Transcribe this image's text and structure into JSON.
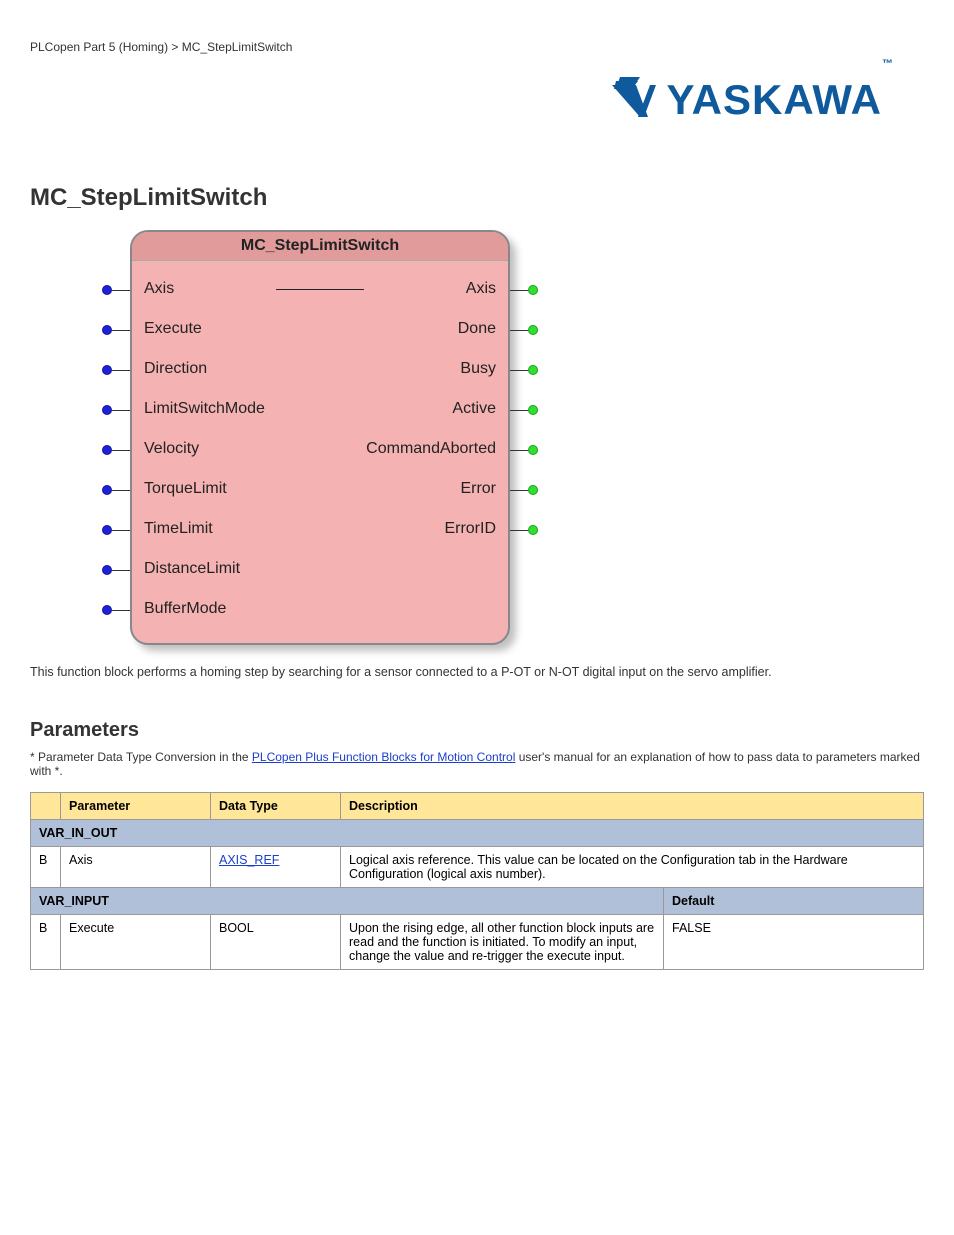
{
  "breadcrumb": "PLCopen Part 5 (Homing) > MC_StepLimitSwitch",
  "logo_text": "YASKAWA",
  "heading": "MC_StepLimitSwitch",
  "fb": {
    "title": "MC_StepLimitSwitch",
    "inputs": [
      "Axis",
      "Execute",
      "Direction",
      "LimitSwitchMode",
      "Velocity",
      "TorqueLimit",
      "TimeLimit",
      "DistanceLimit",
      "BufferMode"
    ],
    "outputs": [
      "Axis",
      "Done",
      "Busy",
      "Active",
      "CommandAborted",
      "Error",
      "ErrorID"
    ]
  },
  "desc": "This function block performs a homing step by searching for a sensor connected to a P-OT or N-OT digital input on the servo amplifier.",
  "params_heading": "Parameters",
  "note_pre": "* Parameter Data Type Conversion in the ",
  "note_link": "PLCopen Plus Function Blocks for Motion Control",
  "note_post": " user's manual for an explanation of how to pass data to parameters marked with *.",
  "table": {
    "header": [
      "",
      "Parameter",
      "Data Type",
      "Description",
      ""
    ],
    "var_in_out": "VAR_IN_OUT",
    "row1": {
      "b": "B",
      "param": "Axis",
      "type": "AXIS_REF",
      "desc": "Logical axis reference. This value can be located on the Configuration tab in the Hardware Configuration (logical axis number)."
    },
    "var_input": "VAR_INPUT",
    "var_input_default": "Default",
    "row2": {
      "b": "B",
      "param": "Execute",
      "type": "BOOL",
      "desc": "Upon the rising edge, all other function block inputs are read and the function is initiated. To modify an input, change the value and re-trigger the execute input.",
      "default": "FALSE"
    }
  }
}
